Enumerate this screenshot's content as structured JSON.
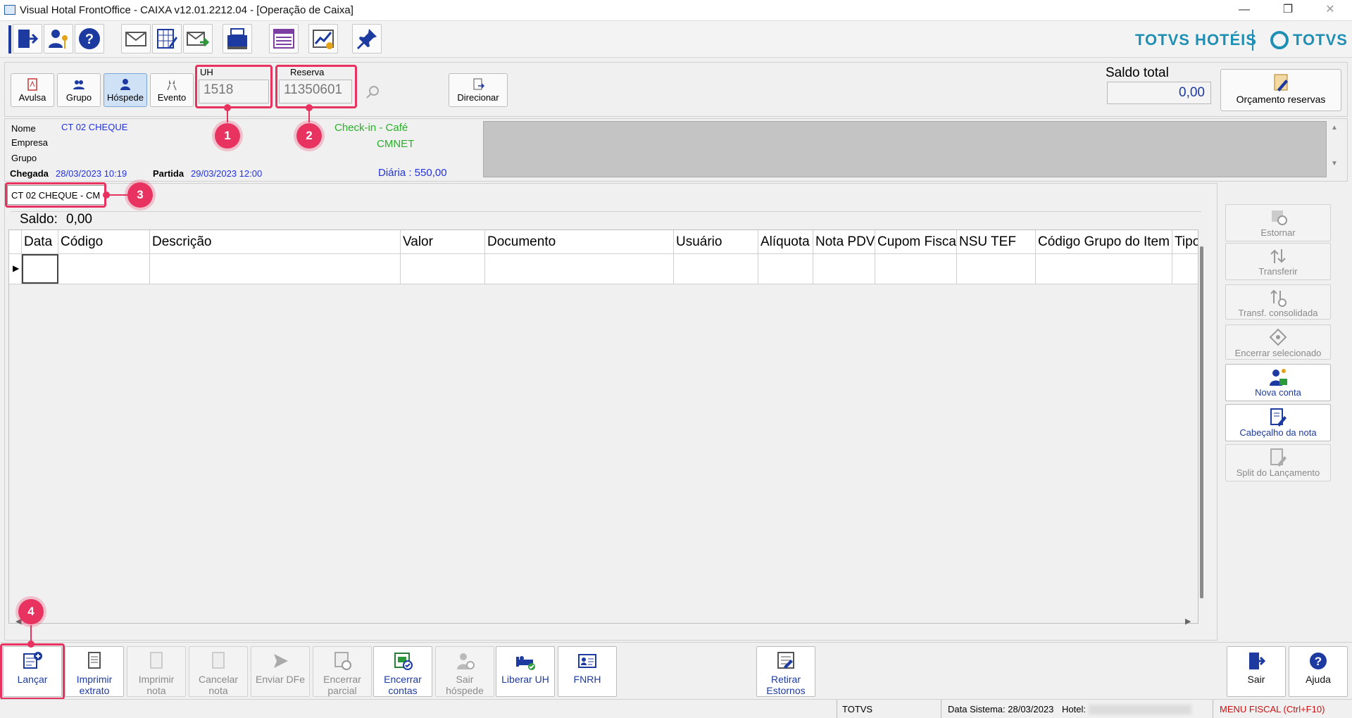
{
  "window": {
    "title": "Visual Hotal FrontOffice - CAIXA v12.01.2212.04 - [Operação de Caixa]",
    "minimize": "—",
    "restore": "❐",
    "close": "✕"
  },
  "brand": {
    "totvs_hoteis": "TOTVS HOTÉIS",
    "totvs": "TOTVS"
  },
  "type_buttons": [
    {
      "label": "Avulsa"
    },
    {
      "label": "Grupo"
    },
    {
      "label": "Hóspede",
      "selected": true
    },
    {
      "label": "Evento"
    }
  ],
  "uh": {
    "label": "UH",
    "value": "1518"
  },
  "reserva": {
    "label": "Reserva",
    "value": "11350601"
  },
  "direcionar": "Direcionar",
  "saldo_total": {
    "label": "Saldo total",
    "value": "0,00"
  },
  "orcamento": "Orçamento reservas",
  "guest": {
    "nome_label": "Nome",
    "nome": "CT 02 CHEQUE",
    "empresa_label": "Empresa",
    "grupo_label": "Grupo",
    "chegada_label": "Chegada",
    "chegada": "28/03/2023 10:19",
    "partida_label": "Partida",
    "partida": "29/03/2023 12:00",
    "checkin": "Check-in -  Café",
    "cmnet": "CMNET",
    "diaria": "Diária : 550,00"
  },
  "account_tab": "CT 02 CHEQUE - CM",
  "saldo": {
    "label": "Saldo:",
    "value": "0,00"
  },
  "grid_columns": [
    "Data",
    "Código",
    "Descrição",
    "Valor",
    "Documento",
    "Usuário",
    "Alíquota",
    "Nota PDV",
    "Cupom Fiscal",
    "NSU TEF",
    "Código Grupo do Item",
    "Tipo"
  ],
  "side_buttons": [
    {
      "label": "Estornar",
      "enabled": false
    },
    {
      "label": "Transferir",
      "enabled": false
    },
    {
      "label": "Transf. consolidada",
      "enabled": false
    },
    {
      "label": "Encerrar selecionado",
      "enabled": false
    },
    {
      "label": "Nova conta",
      "enabled": true
    },
    {
      "label": "Cabeçalho da nota",
      "enabled": true
    },
    {
      "label": "Split do Lançamento",
      "enabled": false
    }
  ],
  "bottom_buttons": [
    {
      "line1": "Lançar",
      "line2": "",
      "enabled": true
    },
    {
      "line1": "Imprimir",
      "line2": "extrato",
      "enabled": true
    },
    {
      "line1": "Imprimir",
      "line2": "nota",
      "enabled": false
    },
    {
      "line1": "Cancelar",
      "line2": "nota",
      "enabled": false
    },
    {
      "line1": "Enviar DFe",
      "line2": "",
      "enabled": false
    },
    {
      "line1": "Encerrar",
      "line2": "parcial",
      "enabled": false
    },
    {
      "line1": "Encerrar",
      "line2": "contas",
      "enabled": true
    },
    {
      "line1": "Sair",
      "line2": "hóspede",
      "enabled": false
    },
    {
      "line1": "Liberar UH",
      "line2": "",
      "enabled": true
    },
    {
      "line1": "FNRH",
      "line2": "",
      "enabled": true
    }
  ],
  "retirar_estornos": {
    "line1": "Retirar",
    "line2": "Estornos"
  },
  "sair": "Sair",
  "ajuda": "Ajuda",
  "callouts": [
    "1",
    "2",
    "3",
    "4"
  ],
  "status": {
    "user": "TOTVS",
    "data_sistema": "Data Sistema: 28/03/2023",
    "hotel_label": "Hotel:",
    "menu_fiscal": "MENU FISCAL (Ctrl+F10)"
  },
  "colors": {
    "accent_blue": "#1d3aa0",
    "callout": "#e8325f",
    "brand": "#1f8fb3",
    "green": "#28b028"
  }
}
